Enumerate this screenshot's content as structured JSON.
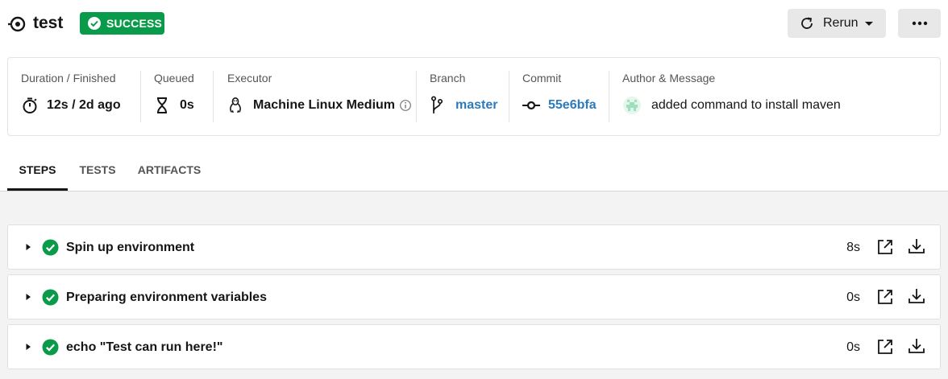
{
  "header": {
    "job_name": "test",
    "status": "SUCCESS",
    "rerun_label": "Rerun"
  },
  "colors": {
    "success": "#0a9b4a",
    "link": "#2b7bbd",
    "text": "#161616",
    "muted": "#555555"
  },
  "info": {
    "duration": {
      "label": "Duration / Finished",
      "value": "12s / 2d ago",
      "icon": "stopwatch-icon"
    },
    "queued": {
      "label": "Queued",
      "value": "0s",
      "icon": "hourglass-icon"
    },
    "executor": {
      "label": "Executor",
      "value": "Machine Linux Medium",
      "icon": "linux-icon"
    },
    "branch": {
      "label": "Branch",
      "value": "master",
      "icon": "branch-icon"
    },
    "commit": {
      "label": "Commit",
      "value": "55e6bfa",
      "icon": "commit-icon"
    },
    "author": {
      "label": "Author & Message",
      "value": "added command to install maven",
      "icon": "avatar"
    }
  },
  "tabs": [
    {
      "label": "STEPS",
      "active": true
    },
    {
      "label": "TESTS",
      "active": false
    },
    {
      "label": "ARTIFACTS",
      "active": false
    }
  ],
  "steps": [
    {
      "title": "Spin up environment",
      "duration": "8s"
    },
    {
      "title": "Preparing environment variables",
      "duration": "0s"
    },
    {
      "title": "echo \"Test can run here!\"",
      "duration": "0s"
    }
  ]
}
